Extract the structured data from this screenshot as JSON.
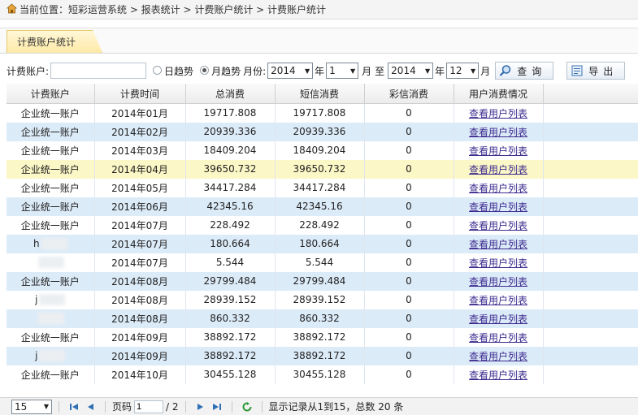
{
  "breadcrumb": "当前位置：短彩运营系统 > 报表统计 > 计费账户统计 > 计费账户统计",
  "tab": {
    "label": "计费账户统计"
  },
  "toolbar": {
    "account_label": "计费账户:",
    "account_value": "",
    "day_trend": "日趋势",
    "month_trend": "月趋势",
    "month_label": "月份:",
    "from_year": "2014",
    "year_unit": "年",
    "from_month": "1",
    "month_unit": "月",
    "to_label": "至",
    "to_year": "2014",
    "to_month": "12",
    "query_label": "查询",
    "export_label": "导出"
  },
  "table": {
    "headers": [
      "计费账户",
      "计费时间",
      "总消费",
      "短信消费",
      "彩信消费",
      "用户消费情况"
    ],
    "link_label": "查看用户列表",
    "rows": [
      {
        "account": "企业统一账户",
        "time": "2014年01月",
        "total": "19717.808",
        "sms": "19717.808",
        "mms": "0"
      },
      {
        "account": "企业统一账户",
        "time": "2014年02月",
        "total": "20939.336",
        "sms": "20939.336",
        "mms": "0"
      },
      {
        "account": "企业统一账户",
        "time": "2014年03月",
        "total": "18409.204",
        "sms": "18409.204",
        "mms": "0"
      },
      {
        "account": "企业统一账户",
        "time": "2014年04月",
        "total": "39650.732",
        "sms": "39650.732",
        "mms": "0"
      },
      {
        "account": "企业统一账户",
        "time": "2014年05月",
        "total": "34417.284",
        "sms": "34417.284",
        "mms": "0"
      },
      {
        "account": "企业统一账户",
        "time": "2014年06月",
        "total": "42345.16",
        "sms": "42345.16",
        "mms": "0"
      },
      {
        "account": "企业统一账户",
        "time": "2014年07月",
        "total": "228.492",
        "sms": "228.492",
        "mms": "0"
      },
      {
        "account": "h",
        "time": "2014年07月",
        "total": "180.664",
        "sms": "180.664",
        "mms": "0"
      },
      {
        "account": "",
        "time": "2014年07月",
        "total": "5.544",
        "sms": "5.544",
        "mms": "0"
      },
      {
        "account": "企业统一账户",
        "time": "2014年08月",
        "total": "29799.484",
        "sms": "29799.484",
        "mms": "0"
      },
      {
        "account": "j",
        "time": "2014年08月",
        "total": "28939.152",
        "sms": "28939.152",
        "mms": "0"
      },
      {
        "account": "",
        "time": "2014年08月",
        "total": "860.332",
        "sms": "860.332",
        "mms": "0"
      },
      {
        "account": "企业统一账户",
        "time": "2014年09月",
        "total": "38892.172",
        "sms": "38892.172",
        "mms": "0"
      },
      {
        "account": "j",
        "time": "2014年09月",
        "total": "38892.172",
        "sms": "38892.172",
        "mms": "0"
      },
      {
        "account": "企业统一账户",
        "time": "2014年10月",
        "total": "30455.128",
        "sms": "30455.128",
        "mms": "0"
      }
    ]
  },
  "pager": {
    "page_size": "15",
    "page_label": "页码",
    "page_current": "1",
    "page_total": "/ 2",
    "summary": "显示记录从1到15，总数 20 条"
  }
}
